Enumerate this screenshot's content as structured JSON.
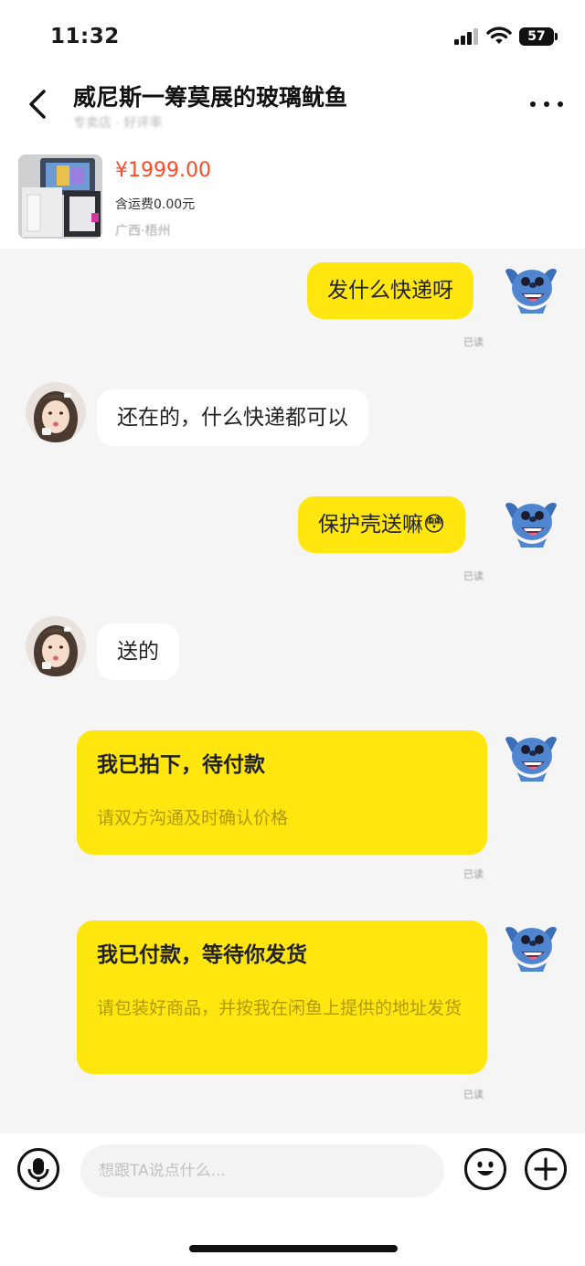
{
  "status": {
    "time": "11:32",
    "battery": "57"
  },
  "header": {
    "title": "威尼斯一筹莫展的玻璃鱿鱼",
    "subtitle": "专卖店 · 好评率"
  },
  "product": {
    "price": "¥1999.00",
    "shipping": "含运费0.00元",
    "location": "广西·梧州"
  },
  "messages": [
    {
      "text": "发什么快递呀",
      "status": "已读"
    },
    {
      "text": "还在的，什么快递都可以"
    },
    {
      "text": "保护壳送嘛😳",
      "status": "已读"
    },
    {
      "text": "送的"
    }
  ],
  "cards": [
    {
      "title": "我已拍下，待付款",
      "desc": "请双方沟通及时确认价格",
      "status": "已读"
    },
    {
      "title": "我已付款，等待你发货",
      "desc": "请包装好商品，并按我在闲鱼上提供的地址发货",
      "status": "已读"
    }
  ],
  "input": {
    "placeholder": "想跟TA说点什么..."
  },
  "colors": {
    "accent": "#ffe60f",
    "price": "#ff4a27",
    "background": "#f5f5f6"
  }
}
